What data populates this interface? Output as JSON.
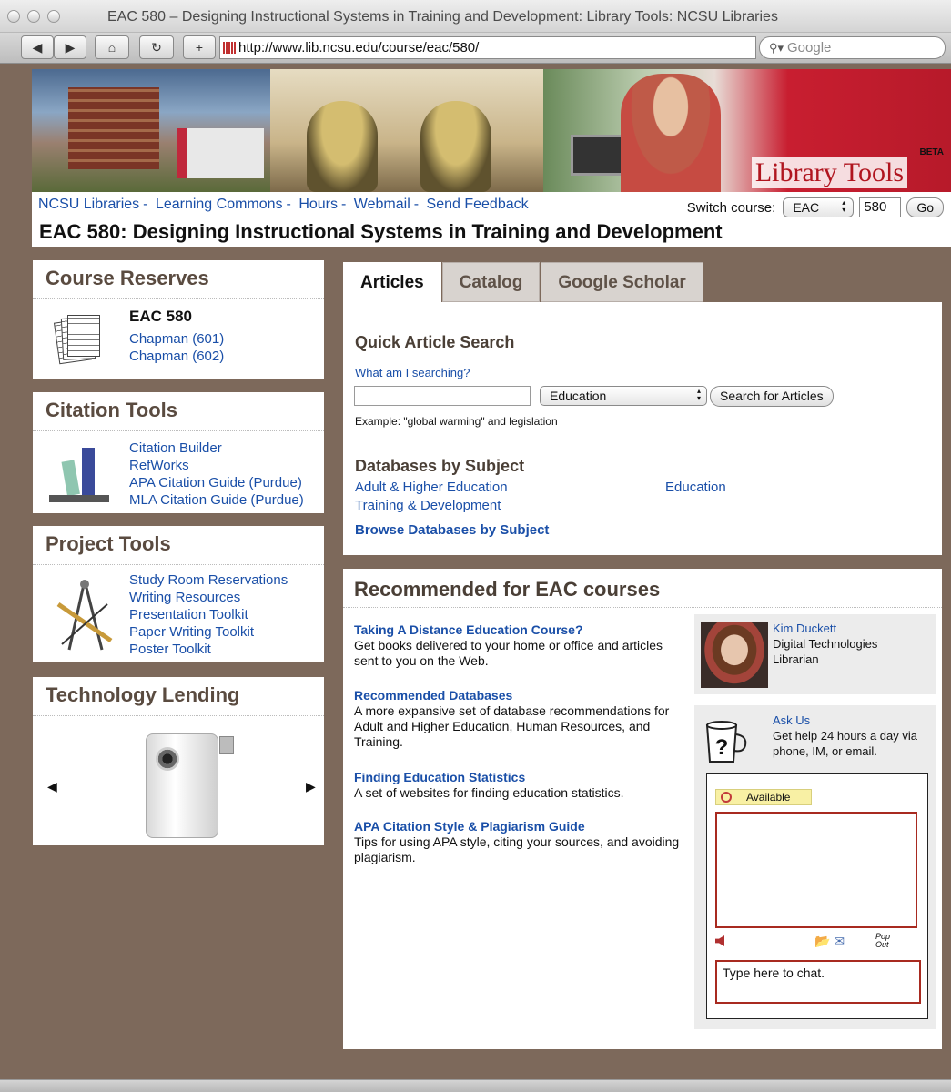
{
  "browser": {
    "window_title": "EAC 580 – Designing Instructional Systems in Training and Development: Library Tools: NCSU Libraries",
    "url": "http://www.lib.ncsu.edu/course/eac/580/",
    "search_placeholder": "Google",
    "buttons": {
      "back": "◀",
      "forward": "▶",
      "home": "⌂",
      "reload": "↻",
      "add": "+"
    }
  },
  "banner": {
    "brand": "Library Tools",
    "beta": "BETA"
  },
  "header": {
    "nav": [
      "NCSU Libraries",
      "Learning Commons",
      "Hours",
      "Webmail",
      "Send Feedback"
    ],
    "separator": "-",
    "switch_label": "Switch course:",
    "switch_subject": "EAC",
    "switch_number": "580",
    "go_label": "Go",
    "course_title": "EAC 580: Designing Instructional Systems in Training and Development"
  },
  "course_reserves": {
    "title": "Course Reserves",
    "course": "EAC 580",
    "links": [
      "Chapman (601)",
      "Chapman (602)"
    ]
  },
  "citation_tools": {
    "title": "Citation Tools",
    "links": [
      "Citation Builder",
      "RefWorks",
      "APA Citation Guide (Purdue)",
      "MLA Citation Guide (Purdue)"
    ]
  },
  "project_tools": {
    "title": "Project Tools",
    "links": [
      "Study Room Reservations",
      "Writing Resources",
      "Presentation Toolkit",
      "Paper Writing Toolkit",
      "Poster Toolkit"
    ]
  },
  "technology_lending": {
    "title": "Technology Lending",
    "prev": "◀",
    "next": "▶"
  },
  "tabs": [
    "Articles",
    "Catalog",
    "Google Scholar"
  ],
  "article_search": {
    "title": "Quick Article Search",
    "help_link": "What am I searching?",
    "query_value": "",
    "subject_selected": "Education",
    "search_button": "Search for Articles",
    "example": "Example: \"global warming\" and legislation"
  },
  "databases": {
    "title": "Databases by Subject",
    "links": [
      "Adult & Higher Education",
      "Education",
      "Training & Development"
    ],
    "browse_link": "Browse Databases by Subject"
  },
  "recommended": {
    "title": "Recommended for EAC courses",
    "items": [
      {
        "title": "Taking A Distance Education Course?",
        "desc": "Get books delivered to your home or office and articles sent to you on the Web."
      },
      {
        "title": "Recommended Databases",
        "desc": "A more expansive set of database recommendations for Adult and Higher Education, Human Resources, and Training."
      },
      {
        "title": "Finding Education Statistics",
        "desc": "A set of websites for finding education statistics."
      },
      {
        "title": "APA Citation Style & Plagiarism Guide",
        "desc": "Tips for using APA style, citing your sources, and avoiding plagiarism."
      }
    ]
  },
  "librarian": {
    "name": "Kim Duckett",
    "role": "Digital Technologies Librarian"
  },
  "ask_us": {
    "title": "Ask Us",
    "desc": "Get help 24 hours a day via phone, IM, or email.",
    "status": "Available",
    "chat_placeholder": "Type here to chat.",
    "popout": "Pop Out"
  }
}
